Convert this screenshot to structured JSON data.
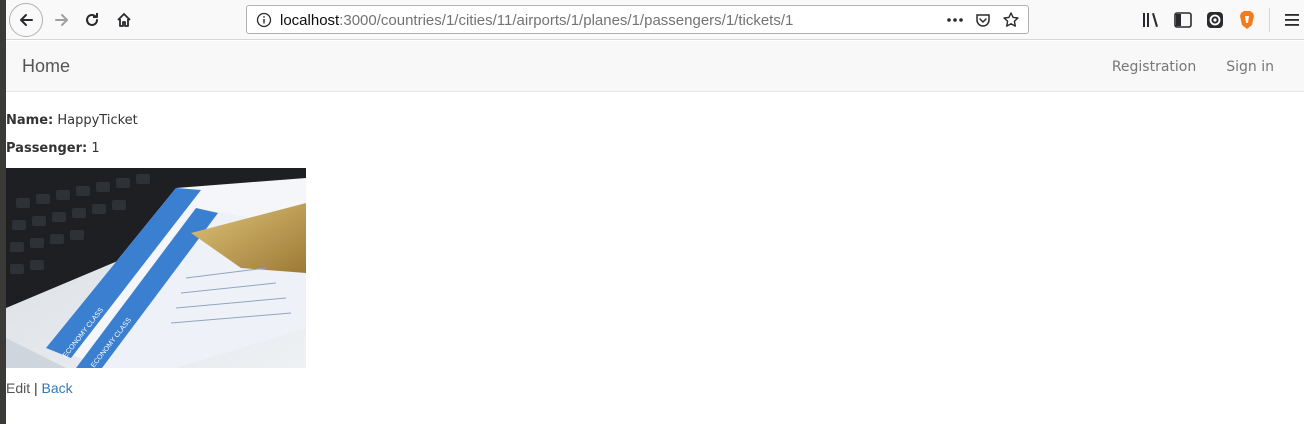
{
  "browser": {
    "url_host": "localhost",
    "url_path": ":3000/countries/1/cities/11/airports/1/planes/1/passengers/1/tickets/1",
    "icons": [
      "back-icon",
      "forward-icon",
      "reload-icon",
      "home-icon",
      "info-icon",
      "more-icon",
      "pocket-icon",
      "bookmark-star-icon",
      "library-icon",
      "sidebar-icon",
      "extension-icon",
      "brave-icon",
      "hamburger-menu-icon"
    ]
  },
  "navbar": {
    "brand": "Home",
    "links": [
      "Registration",
      "Sign in"
    ]
  },
  "ticket": {
    "name_label": "Name:",
    "name_value": "HappyTicket",
    "passenger_label": "Passenger:",
    "passenger_value": "1"
  },
  "image_texts": {
    "economy_1": "ECONOMY CLASS",
    "economy_2": "ECONOMY CLASS"
  },
  "actions": {
    "edit": "Edit",
    "separator": "|",
    "back": "Back"
  },
  "colors": {
    "link": "#337ab7",
    "ticket_blue": "#3b7fd0",
    "card_gold": "#c9a455"
  }
}
